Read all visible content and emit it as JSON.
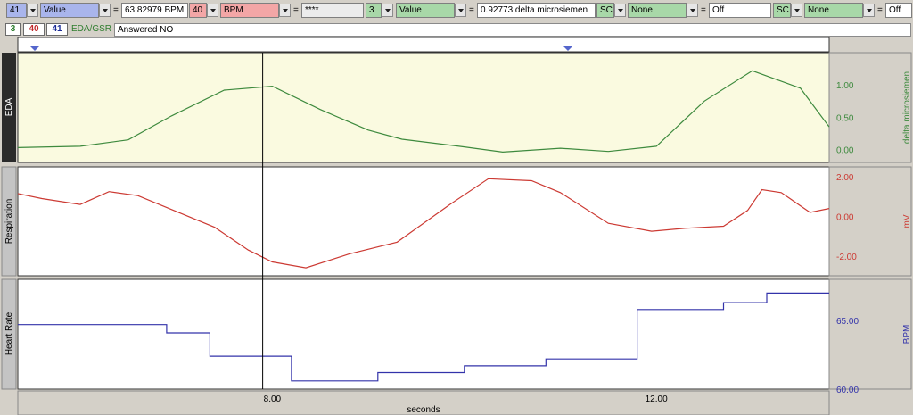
{
  "measurements": [
    {
      "channel": "41",
      "type": "Value",
      "result": "63.82979 BPM"
    },
    {
      "channel": "40",
      "type": "BPM",
      "result": "****"
    },
    {
      "channel": "3",
      "type": "Value",
      "result": "0.92773 delta microsiemen"
    },
    {
      "channel": "SC",
      "type": "None",
      "result": "Off"
    },
    {
      "channel": "SC",
      "type": "None",
      "result": "Off"
    }
  ],
  "equals_sign": "=",
  "channel_buttons": [
    "3",
    "40",
    "41"
  ],
  "selected_channel_label": "EDA/GSR",
  "journal_text": "Answered NO",
  "colors": {
    "eda": "#3e8a3e",
    "respiration": "#cc3a33",
    "heart_rate": "#3333aa",
    "eda_background": "#fafae0"
  },
  "chart_data": [
    {
      "type": "line",
      "panel_label": "EDA",
      "ylabel": "delta microsiemen",
      "ylim": [
        -0.2,
        1.5
      ],
      "y_ticks": [
        "1.00",
        "0.50",
        "0.00"
      ],
      "y_tick_values": [
        1.0,
        0.5,
        0.0
      ],
      "x": [
        5.35,
        6.0,
        6.5,
        6.95,
        7.5,
        8.0,
        8.5,
        9.0,
        9.35,
        10.0,
        10.4,
        11.0,
        11.5,
        12.0,
        12.5,
        13.0,
        13.5,
        13.8
      ],
      "y": [
        0.03,
        0.05,
        0.15,
        0.52,
        0.92,
        0.98,
        0.62,
        0.3,
        0.16,
        0.04,
        -0.04,
        0.02,
        -0.03,
        0.05,
        0.75,
        1.22,
        0.95,
        0.35
      ]
    },
    {
      "type": "line",
      "panel_label": "Respiration",
      "ylabel": "mV",
      "ylim": [
        -3.0,
        2.5
      ],
      "y_ticks": [
        "2.00",
        "0.00",
        "-2.00"
      ],
      "y_tick_values": [
        2.0,
        0.0,
        -2.0
      ],
      "x": [
        5.35,
        5.6,
        6.0,
        6.3,
        6.6,
        7.0,
        7.4,
        7.75,
        8.0,
        8.35,
        8.8,
        9.3,
        9.85,
        10.25,
        10.7,
        11.0,
        11.5,
        11.95,
        12.3,
        12.7,
        12.95,
        13.1,
        13.3,
        13.6,
        13.8
      ],
      "y": [
        1.15,
        0.9,
        0.6,
        1.25,
        1.05,
        0.25,
        -0.55,
        -1.7,
        -2.3,
        -2.6,
        -1.9,
        -1.3,
        0.6,
        1.9,
        1.8,
        1.2,
        -0.35,
        -0.75,
        -0.6,
        -0.5,
        0.3,
        1.35,
        1.2,
        0.2,
        0.4
      ]
    },
    {
      "type": "line",
      "panel_label": "Heart Rate",
      "ylabel": "BPM",
      "ylim": [
        60.0,
        68.0
      ],
      "y_ticks": [
        "65.00",
        "60.00"
      ],
      "y_tick_values": [
        65.0,
        60.0
      ],
      "x": [
        5.35,
        6.9,
        6.9,
        7.35,
        7.35,
        8.2,
        8.2,
        9.1,
        9.1,
        10.0,
        10.0,
        10.85,
        10.85,
        11.8,
        11.8,
        12.7,
        12.7,
        13.15,
        13.15,
        13.8
      ],
      "y": [
        64.7,
        64.7,
        64.1,
        64.1,
        62.4,
        62.4,
        60.6,
        60.6,
        61.2,
        61.2,
        61.7,
        61.7,
        62.2,
        62.2,
        65.8,
        65.8,
        66.3,
        66.3,
        67.0,
        67.0
      ]
    }
  ],
  "x_axis": {
    "label": "seconds",
    "ticks": [
      "8.00",
      "12.00"
    ],
    "tick_values": [
      8.0,
      12.0
    ],
    "xlim": [
      5.35,
      13.8
    ],
    "cursor_x": 7.9
  }
}
